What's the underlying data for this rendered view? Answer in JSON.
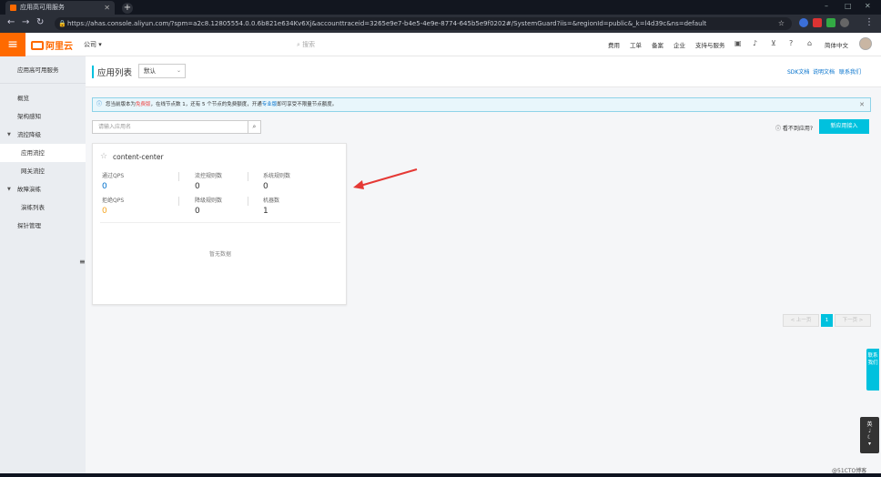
{
  "browser": {
    "tab_title": "应用高可用服务",
    "url": "https://ahas.console.aliyun.com/?spm=a2c8.12805554.0.0.6b821e634Kv6Xj&accounttraceid=3265e9e7-b4e5-4e9e-8774-645b5e9f0202#/SystemGuard?iis=&regionId=public&_k=l4d39c&ns=default",
    "window_controls": [
      "–",
      "□",
      "✕"
    ],
    "new_tab": "+"
  },
  "header": {
    "logo_text": "阿里云",
    "company": "公司 ▾",
    "search_placeholder": "搜索",
    "nav": [
      "费用",
      "工单",
      "备案",
      "企业",
      "支持与服务"
    ],
    "lang": "简体中文"
  },
  "sidebar": {
    "title": "应用高可用服务",
    "items": [
      {
        "label": "概览",
        "level": 0
      },
      {
        "label": "架构感知",
        "level": 0
      },
      {
        "label": "流控降级",
        "level": 0,
        "expanded": true
      },
      {
        "label": "应用流控",
        "level": 1,
        "active": true
      },
      {
        "label": "网关流控",
        "level": 1
      },
      {
        "label": "故障演练",
        "level": 0,
        "expanded": true
      },
      {
        "label": "演练列表",
        "level": 1
      },
      {
        "label": "探针管理",
        "level": 0
      }
    ]
  },
  "page": {
    "title": "应用列表",
    "env_select": "默认",
    "links": [
      "SDK文档",
      "说明文档",
      "联系我们"
    ],
    "notice": {
      "prefix": "您当前版本为",
      "version": "免费版",
      "middle": "，在线节点数 1，还有 5 个节点的免费额度，开通",
      "link": "专业版",
      "suffix": "即可享受不限量节点额度。"
    },
    "search_placeholder": "请输入应用名",
    "hint": "看不到应用?",
    "new_app_button": "新应用接入",
    "card": {
      "name": "content-center",
      "metrics": [
        {
          "label": "通过QPS",
          "value": "0",
          "color": "#0070cc"
        },
        {
          "label": "流控规则数",
          "value": "0",
          "color": "#333333"
        },
        {
          "label": "系统规则数",
          "value": "0",
          "color": "#333333"
        },
        {
          "label": "拒绝QPS",
          "value": "0",
          "color": "#f5a623"
        },
        {
          "label": "降级规则数",
          "value": "0",
          "color": "#333333"
        },
        {
          "label": "机器数",
          "value": "1",
          "color": "#333333"
        }
      ],
      "empty_text": "暂无数据"
    },
    "pager": {
      "prev": "< 上一页",
      "current": "1",
      "next": "下一页 >"
    }
  },
  "floating": {
    "feedback": "联系我们",
    "tools_top": "英"
  },
  "watermark": "@51CTO博客",
  "colors": {
    "brand": "#ff6a00",
    "accent": "#00c1de",
    "link": "#0070cc",
    "arrow": "#e53935"
  }
}
